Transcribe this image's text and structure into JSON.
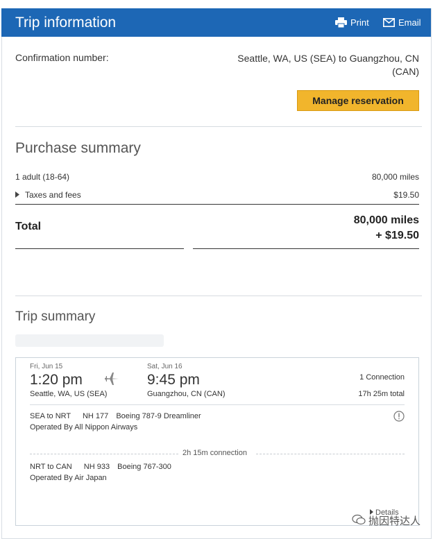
{
  "header": {
    "title": "Trip information",
    "print_label": "Print",
    "email_label": "Email"
  },
  "confirmation": {
    "label": "Confirmation number:",
    "route_line1": "Seattle, WA, US (SEA) to Guangzhou, CN",
    "route_line2": "(CAN)"
  },
  "manage_button": "Manage reservation",
  "purchase": {
    "title": "Purchase summary",
    "adult_label": "1 adult (18-64)",
    "adult_value": "80,000 miles",
    "taxes_label": "Taxes and fees",
    "taxes_value": "$19.50",
    "total_label": "Total",
    "total_miles": "80,000 miles",
    "total_cash": "+ $19.50"
  },
  "trip_summary": {
    "title": "Trip summary",
    "depart_day": "Fri, Jun 15",
    "depart_time": "1:20 pm",
    "depart_city": "Seattle, WA, US (SEA)",
    "arrive_day": "Sat, Jun 16",
    "arrive_time": "9:45 pm",
    "arrive_city": "Guangzhou, CN (CAN)",
    "connections": "1 Connection",
    "duration": "17h 25m total",
    "segments": [
      {
        "route": "SEA to NRT",
        "flight": "NH 177",
        "aircraft": "Boeing 787-9 Dreamliner",
        "operated": "Operated By All Nippon Airways"
      },
      {
        "route": "NRT to CAN",
        "flight": "NH 933",
        "aircraft": "Boeing 767-300",
        "operated": "Operated By Air Japan"
      }
    ],
    "layover": "2h 15m connection",
    "details_link": "Details"
  },
  "watermark": "抛因特达人",
  "colors": {
    "header_bg": "#1d67b5",
    "button_bg": "#f1b52c"
  }
}
